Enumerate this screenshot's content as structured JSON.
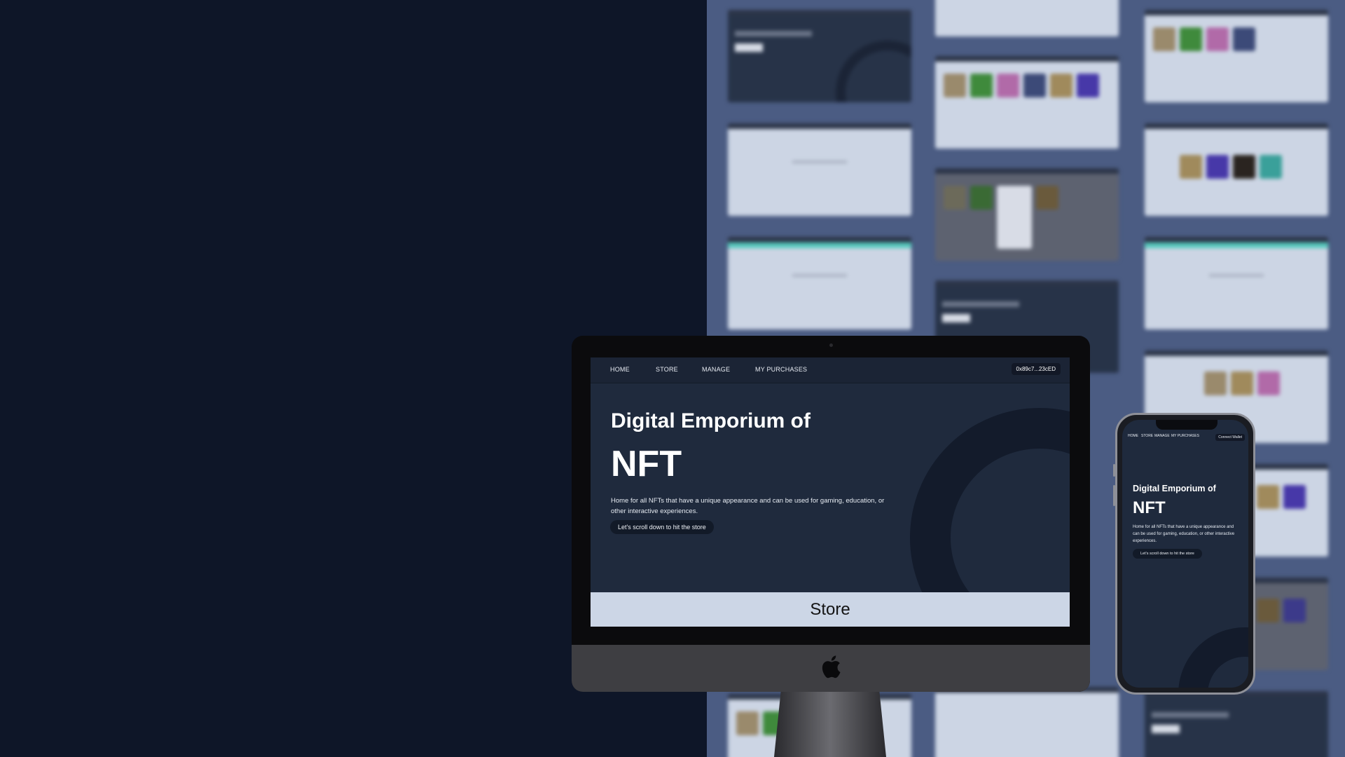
{
  "desktop": {
    "nav": {
      "items": [
        "HOME",
        "STORE",
        "MANAGE",
        "MY PURCHASES"
      ],
      "wallet_label": "0x89c7...23cED"
    },
    "hero": {
      "title_line1": "Digital Emporium of",
      "title_line2": "NFT",
      "description": "Home for all NFTs that have a unique appearance and can be used for gaming, education, or other interactive experiences.",
      "cta_label": "Let's scroll down to hit the store"
    },
    "store_heading": "Store"
  },
  "mobile": {
    "nav": {
      "items": [
        "HOME",
        "STORE",
        "MANAGE",
        "MY PURCHASES"
      ],
      "wallet_label": "Connect Wallet"
    },
    "hero": {
      "title_line1": "Digital Emporium of",
      "title_line2": "NFT",
      "description": "Home for all NFTs that have a unique appearance and can be used for gaming, education, or other interactive experiences.",
      "cta_label": "Let's scroll down to hit the store"
    }
  },
  "colors": {
    "page_background": "#0e1628",
    "collage_background": "#4b5c83",
    "app_background": "#1f2a3d",
    "store_band": "#ccd6e6",
    "accent_teal": "#55c9bc"
  },
  "icons": [
    "apple-logo-icon"
  ]
}
